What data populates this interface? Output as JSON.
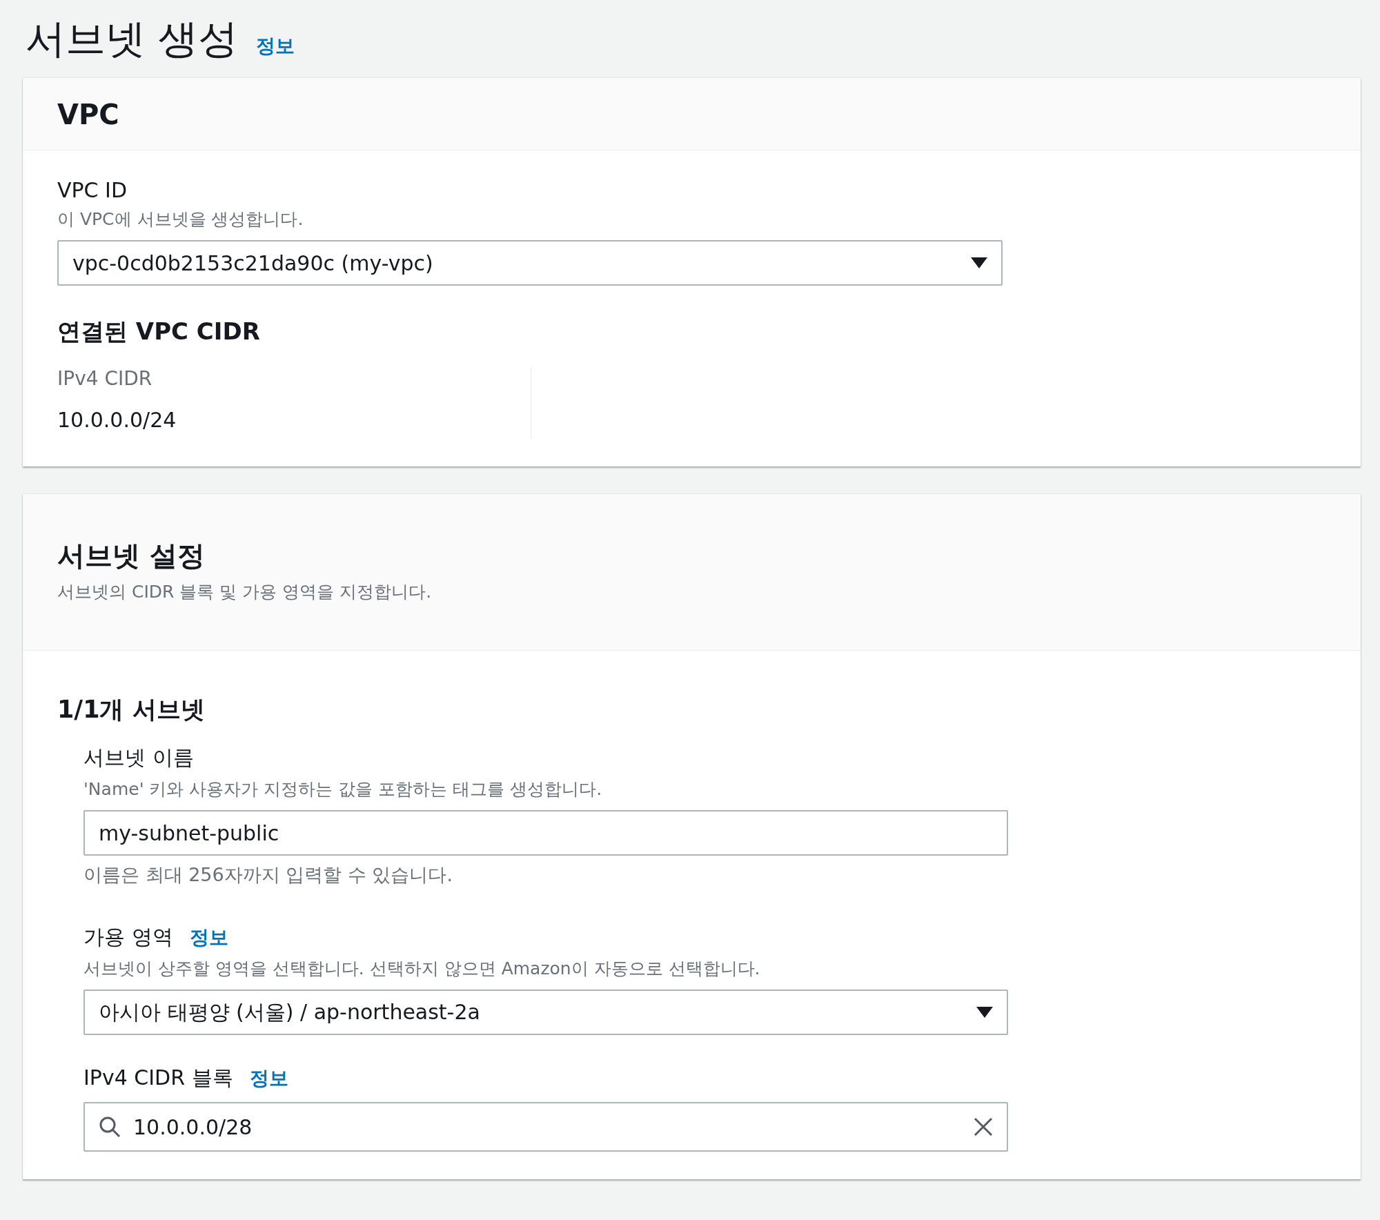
{
  "page": {
    "title": "서브넷 생성",
    "info_link": "정보"
  },
  "vpc_section": {
    "heading": "VPC",
    "vpc_id": {
      "label": "VPC ID",
      "description": "이 VPC에 서브넷을 생성합니다.",
      "value": "vpc-0cd0b2153c21da90c (my-vpc)"
    },
    "cidr_heading": "연결된 VPC CIDR",
    "cidr_columns": [
      {
        "label": "IPv4 CIDR",
        "value": "10.0.0.0/24"
      }
    ]
  },
  "subnet_section": {
    "heading": "서브넷 설정",
    "description": "서브넷의 CIDR 블록 및 가용 영역을 지정합니다.",
    "subnet_heading": "1/1개 서브넷",
    "fields": [
      {
        "kind": "text",
        "label": "서브넷 이름",
        "description": "'Name' 키와 사용자가 지정하는 값을 포함하는 태그를 생성합니다.",
        "value": "my-subnet-public",
        "hint": "이름은 최대 256자까지 입력할 수 있습니다."
      },
      {
        "kind": "select",
        "label": "가용 영역",
        "info_link": "정보",
        "description": "서브넷이 상주할 영역을 선택합니다. 선택하지 않으면 Amazon이 자동으로 선택합니다.",
        "value": "아시아 태평양 (서울) / ap-northeast-2a"
      },
      {
        "kind": "search",
        "label": "IPv4 CIDR 블록",
        "info_link": "정보",
        "value": "10.0.0.0/28"
      }
    ]
  }
}
